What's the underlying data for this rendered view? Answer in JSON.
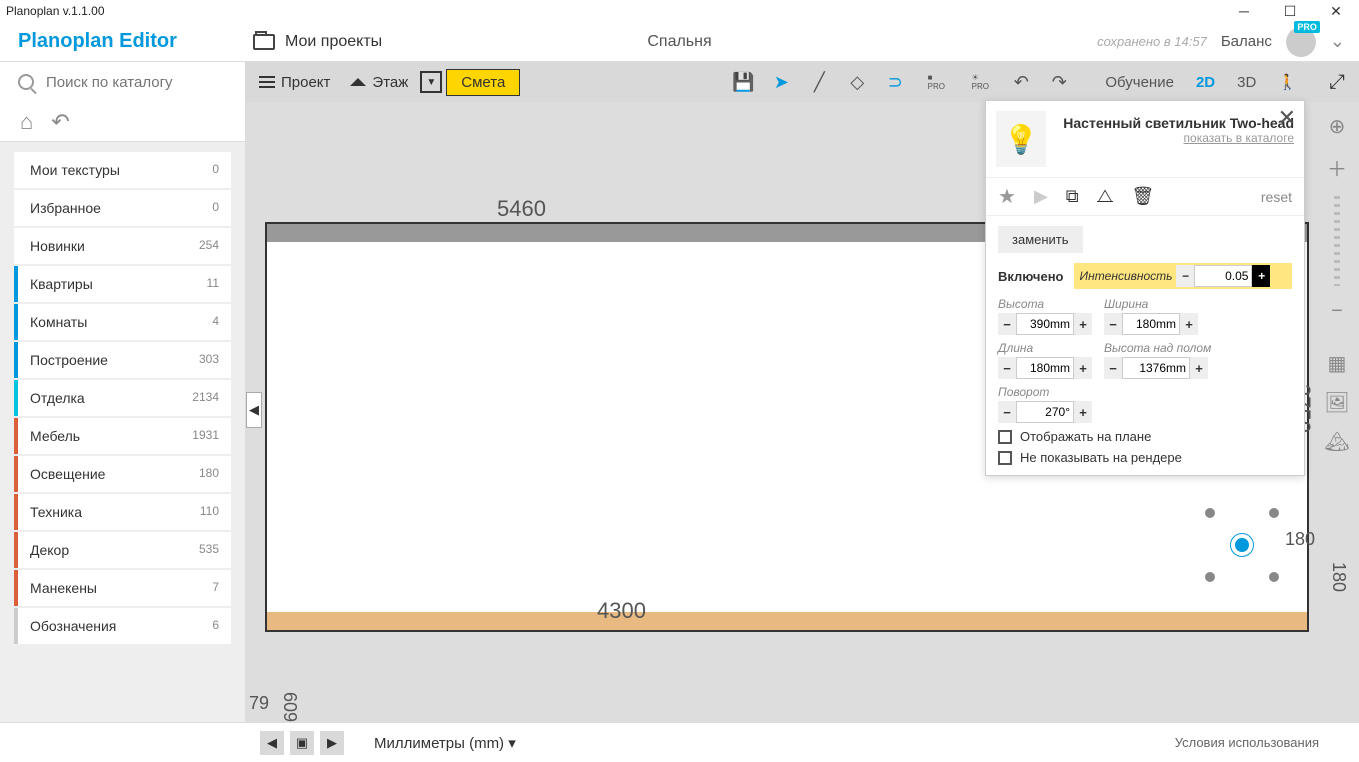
{
  "window": {
    "title": "Planoplan v.1.1.00"
  },
  "header": {
    "logo": "Planoplan Editor",
    "my_projects": "Мои проекты",
    "room_name": "Спальня",
    "saved_at": "сохранено в 14:57",
    "balance": "Баланс",
    "pro": "PRO"
  },
  "search": {
    "placeholder": "Поиск по каталогу"
  },
  "toolbar": {
    "project": "Проект",
    "floor": "Этаж",
    "estimate": "Смета",
    "training": "Обучение",
    "v2d": "2D",
    "v3d": "3D"
  },
  "categories": [
    {
      "name": "Мои текстуры",
      "count": "0",
      "cls": ""
    },
    {
      "name": "Избранное",
      "count": "0",
      "cls": ""
    },
    {
      "name": "Новинки",
      "count": "254",
      "cls": ""
    },
    {
      "name": "Квартиры",
      "count": "11",
      "cls": "blue"
    },
    {
      "name": "Комнаты",
      "count": "4",
      "cls": "blue"
    },
    {
      "name": "Построение",
      "count": "303",
      "cls": "blue"
    },
    {
      "name": "Отделка",
      "count": "2134",
      "cls": "cyan"
    },
    {
      "name": "Мебель",
      "count": "1931",
      "cls": "orange"
    },
    {
      "name": "Освещение",
      "count": "180",
      "cls": "orange"
    },
    {
      "name": "Техника",
      "count": "110",
      "cls": "orange"
    },
    {
      "name": "Декор",
      "count": "535",
      "cls": "orange"
    },
    {
      "name": "Манекены",
      "count": "7",
      "cls": "orange"
    },
    {
      "name": "Обозначения",
      "count": "6",
      "cls": "grey"
    }
  ],
  "canvas": {
    "dim_top": "5460",
    "dim_right": "2750",
    "dim_bottom": "4300",
    "dim_small1": "180",
    "dim_small2": "180",
    "dim_left1": "79",
    "dim_left2": "609"
  },
  "inspector": {
    "title": "Настенный светильник Two-head",
    "catalog_link": "показать в каталоге",
    "reset": "reset",
    "replace": "заменить",
    "enabled": "Включено",
    "intensity_lbl": "Интенсивность",
    "intensity_val": "0.05",
    "height_lbl": "Высота",
    "height_val": "390mm",
    "width_lbl": "Ширина",
    "width_val": "180mm",
    "length_lbl": "Длина",
    "length_val": "180mm",
    "above_lbl": "Высота над полом",
    "above_val": "1376mm",
    "rot_lbl": "Поворот",
    "rot_val": "270°",
    "show_plan": "Отображать на плане",
    "hide_render": "Не показывать на рендере"
  },
  "footer": {
    "units": "Миллиметры (mm)",
    "terms": "Условия использования"
  }
}
